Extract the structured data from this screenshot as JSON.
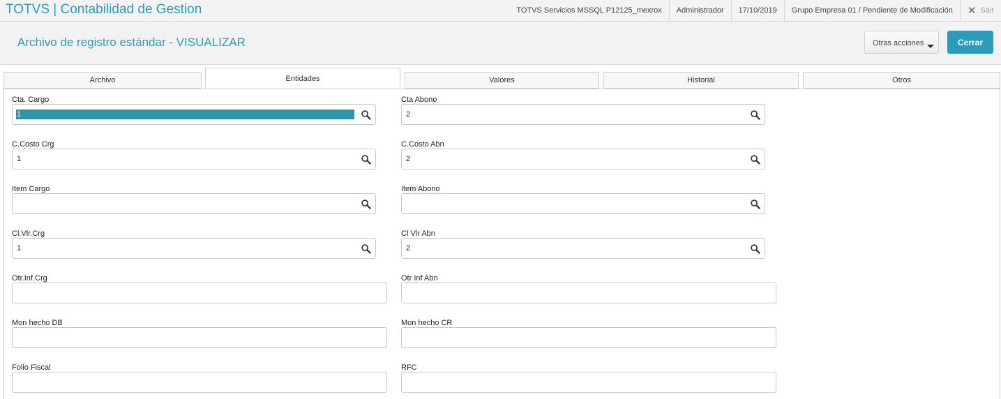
{
  "app": {
    "title": "TOTVS | Contabilidad de Gestion",
    "environment": "TOTVS Servicios MSSQL P12125_mexrox",
    "user": "Administrador",
    "date": "17/10/2019",
    "company": "Grupo Empresa 01 / Pendiente de Modificación",
    "exit_label": "Sair"
  },
  "header": {
    "title": "Archivo de registro estándar - VISUALIZAR",
    "other_actions_label": "Otras acciones",
    "close_label": "Cerrar"
  },
  "tabs": [
    {
      "label": "Archivo",
      "active": false
    },
    {
      "label": "Entidades",
      "active": true
    },
    {
      "label": "Valores",
      "active": false
    },
    {
      "label": "Historial",
      "active": false
    },
    {
      "label": "Otros",
      "active": false
    }
  ],
  "fields": {
    "cta_cargo": {
      "label": "Cta. Cargo",
      "value": "1"
    },
    "cta_abono": {
      "label": "Cta Abono",
      "value": "2"
    },
    "ccosto_crg": {
      "label": "C.Costo Crg",
      "value": "1"
    },
    "ccosto_abn": {
      "label": "C.Costo Abn",
      "value": "2"
    },
    "item_cargo": {
      "label": "Item Cargo",
      "value": ""
    },
    "item_abono": {
      "label": "Item Abono",
      "value": ""
    },
    "clvlr_crg": {
      "label": "Cl.Vlr.Crg",
      "value": "1"
    },
    "clvlr_abn": {
      "label": "Cl Vlr Abn",
      "value": "2"
    },
    "otrinf_crg": {
      "label": "Otr.Inf.Crg",
      "value": ""
    },
    "otrinf_abn": {
      "label": "Otr Inf Abn",
      "value": ""
    },
    "mon_hecho_db": {
      "label": "Mon hecho DB",
      "value": ""
    },
    "mon_hecho_cr": {
      "label": "Mon hecho CR",
      "value": ""
    },
    "folio_fiscal": {
      "label": "Folio Fiscal",
      "value": ""
    },
    "rfc": {
      "label": "RFC",
      "value": ""
    }
  },
  "colors": {
    "accent": "#2a9cb8",
    "selection": "#2e95a6"
  },
  "icons": {
    "lookup": "magnifier-icon",
    "exit": "close-icon",
    "dropdown": "caret-down-icon"
  }
}
